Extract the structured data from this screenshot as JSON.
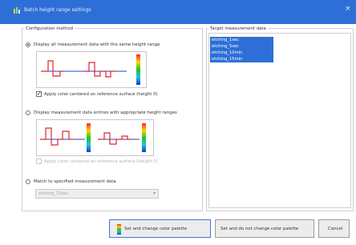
{
  "window": {
    "title": "Batch height range settings",
    "close_glyph": "×",
    "icon": "app-icon"
  },
  "configuration": {
    "group_title": "Configuration method",
    "option1": {
      "label": "Display all measurement data with the same height range",
      "selected": true,
      "checkbox_label": "Apply color centered on reference surface (height 0)",
      "checkbox_checked": true,
      "checkbox_enabled": true
    },
    "option2": {
      "label": "Display measurement data entries with appropriate height ranges",
      "selected": false,
      "checkbox_label": "Apply color centered on reference surface (height 0)",
      "checkbox_checked": false,
      "checkbox_enabled": false
    },
    "option3": {
      "label": "Match to specified measurement data",
      "selected": false,
      "select_value": "etching_10sec",
      "select_enabled": false
    }
  },
  "targets": {
    "group_title": "Target measurement data",
    "items": [
      "etching_1sec",
      "etching_5sec",
      "etching_10min",
      "etching_15min"
    ],
    "selected_color": "#2d6fd6"
  },
  "buttons": {
    "set_and_change": "Set and change color palette",
    "set_no_change": "Set and do not change color palette",
    "cancel": "Cancel"
  },
  "colors": {
    "titlebar": "#2d6fd6",
    "profile_line": "#e0252b",
    "reference_line": "#2a3fd0"
  }
}
